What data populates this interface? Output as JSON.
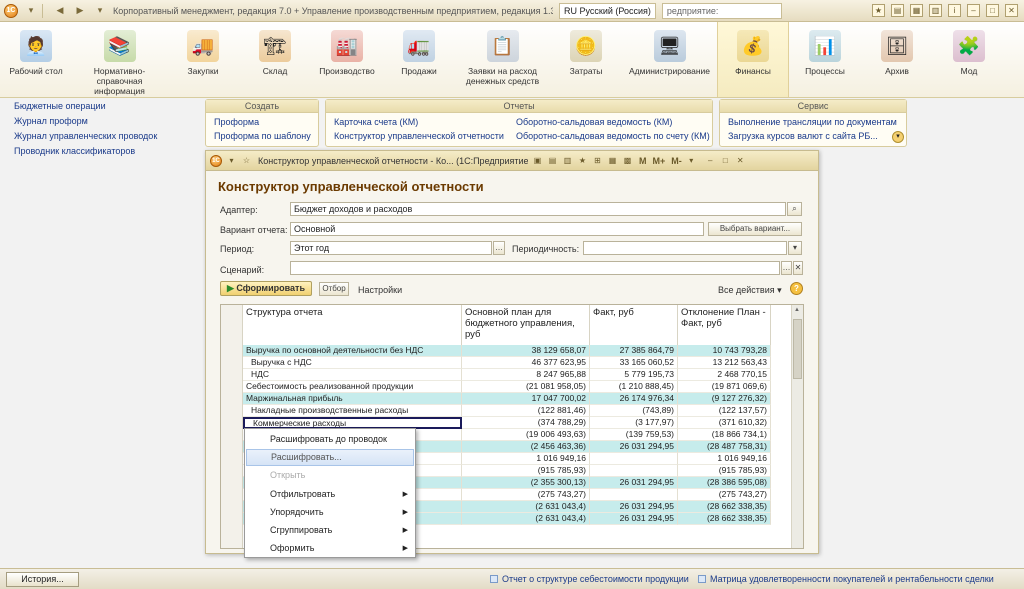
{
  "titlebar": {
    "title": "Корпоративный менеджмент, редакция 7.0 + Управление производственным предприятием, редакция 1.3",
    "lang": "RU Русский (Россия)",
    "search": "редприятие:"
  },
  "sections": [
    {
      "label": "Рабочий стол",
      "icon": "desktop-icon",
      "emoji": "🧑‍💼"
    },
    {
      "label": "Нормативно-справочная информация",
      "icon": "binders-icon",
      "emoji": "📚"
    },
    {
      "label": "Закупки",
      "icon": "truck-icon",
      "emoji": "🚚"
    },
    {
      "label": "Склад",
      "icon": "forklift-icon",
      "emoji": "🏗"
    },
    {
      "label": "Производство",
      "icon": "factory-icon",
      "emoji": "🏭"
    },
    {
      "label": "Продажи",
      "icon": "delivery-truck-icon",
      "emoji": "🚛"
    },
    {
      "label": "Заявки на расход денежных средств",
      "icon": "clipboard-icon",
      "emoji": "📋"
    },
    {
      "label": "Затраты",
      "icon": "coins-icon",
      "emoji": "🪙"
    },
    {
      "label": "Администрирование",
      "icon": "computer-icon",
      "emoji": "🖥"
    },
    {
      "label": "Финансы",
      "icon": "finance-icon",
      "emoji": "💰"
    },
    {
      "label": "Процессы",
      "icon": "process-icon",
      "emoji": "📊"
    },
    {
      "label": "Архив",
      "icon": "archive-icon",
      "emoji": "🗄"
    },
    {
      "label": "Мод",
      "icon": "module-icon",
      "emoji": "🧩"
    }
  ],
  "leftnav": [
    "Бюджетные операции",
    "Журнал проформ",
    "Журнал управленческих проводок",
    "Проводник классификаторов"
  ],
  "actions": {
    "create": {
      "title": "Создать",
      "links": [
        "Проформа",
        "Проформа по шаблону"
      ]
    },
    "reports": {
      "title": "Отчеты",
      "links": [
        "Карточка счета (КМ)",
        "Конструктор управленческой отчетности",
        "Оборотно-сальдовая ведомость (КМ)",
        "Оборотно-сальдовая ведомость по счету (КМ)"
      ]
    },
    "service": {
      "title": "Сервис",
      "links": [
        "Выполнение трансляции по документам",
        "Загрузка курсов валют с сайта РБ..."
      ]
    }
  },
  "subwindow": {
    "title": "Конструктор управленческой отчетности - Ко... (1С:Предприятие)",
    "toolbar_m": "M",
    "toolbar_mplus": "M+",
    "toolbar_mminus": "M-",
    "form_title": "Конструктор управленческой отчетности",
    "adapter_label": "Адаптер:",
    "adapter_value": "Бюджет доходов и расходов",
    "variant_label": "Вариант отчета:",
    "variant_value": "Основной",
    "variant_button": "Выбрать вариант...",
    "period_label": "Период:",
    "period_value": "Этот год",
    "periodicity_label": "Периодичность:",
    "periodicity_value": "",
    "scenario_label": "Сценарий:",
    "scenario_value": "",
    "generate_button": "Сформировать",
    "filter_button": "Отбор",
    "settings_link": "Настройки",
    "all_actions": "Все действия",
    "help": "?"
  },
  "table": {
    "headers": [
      "Структура отчета",
      "Основной план для бюджетного управления, руб",
      "Факт, руб",
      "Отклонение План - Факт, руб"
    ],
    "rows": [
      {
        "name": "Выручка по основной деятельности без НДС",
        "plan": "38 129 658,07",
        "fact": "27 385 864,79",
        "dev": "10 743 793,28",
        "hl": true,
        "indent": 0
      },
      {
        "name": "Выручка с НДС",
        "plan": "46 377 623,95",
        "fact": "33 165 060,52",
        "dev": "13 212 563,43",
        "hl": false,
        "indent": 1
      },
      {
        "name": "НДС",
        "plan": "8 247 965,88",
        "fact": "5 779 195,73",
        "dev": "2 468 770,15",
        "hl": false,
        "indent": 1
      },
      {
        "name": "Себестоимость реализованной продукции",
        "plan": "(21 081 958,05)",
        "fact": "(1 210 888,45)",
        "dev": "(19 871 069,6)",
        "hl": false,
        "indent": 0
      },
      {
        "name": "Маржинальная прибыль",
        "plan": "17 047 700,02",
        "fact": "26 174 976,34",
        "dev": "(9 127 276,32)",
        "hl": true,
        "indent": 0
      },
      {
        "name": "Накладные производственные расходы",
        "plan": "(122 881,46)",
        "fact": "(743,89)",
        "dev": "(122 137,57)",
        "hl": false,
        "indent": 1
      },
      {
        "name": "Коммерческие расходы",
        "plan": "(374 788,29)",
        "fact": "(3 177,97)",
        "dev": "(371 610,32)",
        "hl": false,
        "indent": 1,
        "sel": true
      },
      {
        "name": "",
        "plan": "(19 006 493,63)",
        "fact": "(139 759,53)",
        "dev": "(18 866 734,1)",
        "hl": false,
        "indent": 0
      },
      {
        "name": "",
        "plan": "(2 456 463,36)",
        "fact": "26 031 294,95",
        "dev": "(28 487 758,31)",
        "hl": true,
        "indent": 0
      },
      {
        "name": "",
        "plan": "1 016 949,16",
        "fact": "",
        "dev": "1 016 949,16",
        "hl": false,
        "indent": 0
      },
      {
        "name": "",
        "plan": "(915 785,93)",
        "fact": "",
        "dev": "(915 785,93)",
        "hl": false,
        "indent": 0
      },
      {
        "name": "",
        "plan": "(2 355 300,13)",
        "fact": "26 031 294,95",
        "dev": "(28 386 595,08)",
        "hl": true,
        "indent": 0
      },
      {
        "name": "",
        "plan": "(275 743,27)",
        "fact": "",
        "dev": "(275 743,27)",
        "hl": false,
        "indent": 0
      },
      {
        "name": "",
        "plan": "(2 631 043,4)",
        "fact": "26 031 294,95",
        "dev": "(28 662 338,35)",
        "hl": true,
        "indent": 0
      },
      {
        "name": "",
        "plan": "(2 631 043,4)",
        "fact": "26 031 294,95",
        "dev": "(28 662 338,35)",
        "hl": true,
        "indent": 0
      }
    ]
  },
  "context_menu": [
    {
      "label": "Расшифровать до проводок",
      "state": "normal",
      "submenu": false
    },
    {
      "label": "Расшифровать...",
      "state": "hover",
      "submenu": false
    },
    {
      "label": "Открыть",
      "state": "disabled",
      "submenu": false
    },
    {
      "label": "Отфильтровать",
      "state": "normal",
      "submenu": true
    },
    {
      "label": "Упорядочить",
      "state": "normal",
      "submenu": true
    },
    {
      "label": "Сгруппировать",
      "state": "normal",
      "submenu": true
    },
    {
      "label": "Оформить",
      "state": "normal",
      "submenu": true
    }
  ],
  "statusbar": {
    "history": "История...",
    "links": [
      "Отчет о структуре себестоимости продукции",
      "Матрица удовлетворенности покупателей и рентабельности сделки"
    ]
  }
}
